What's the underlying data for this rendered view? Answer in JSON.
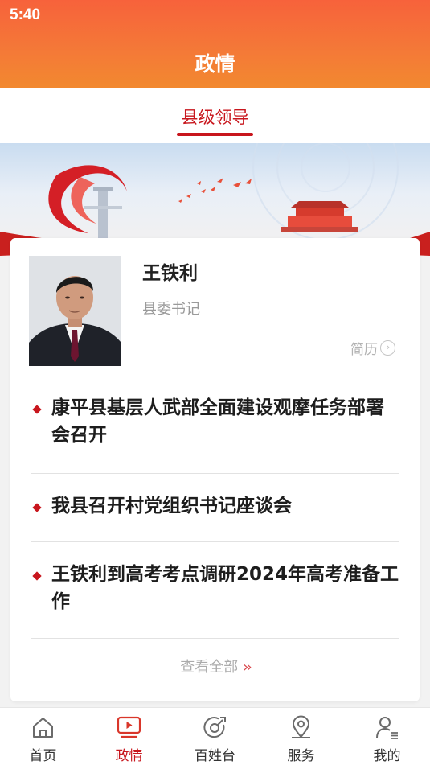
{
  "status_bar": {
    "time": "5:40"
  },
  "header": {
    "title": "政情"
  },
  "subtabs": [
    {
      "label": "县级领导",
      "active": true
    }
  ],
  "leader": {
    "name": "王铁利",
    "position": "县委书记",
    "bio_link": "简历"
  },
  "news": [
    {
      "title": "康平县基层人武部全面建设观摩任务部署会召开"
    },
    {
      "title": "我县召开村党组织书记座谈会"
    },
    {
      "title": "王铁利到高考考点调研2024年高考准备工作"
    }
  ],
  "view_all": {
    "label": "查看全部"
  },
  "bottom_nav": {
    "items": [
      {
        "label": "首页",
        "icon": "home-icon",
        "active": false
      },
      {
        "label": "政情",
        "icon": "video-screen-icon",
        "active": true
      },
      {
        "label": "百姓台",
        "icon": "chat-dial-icon",
        "active": false
      },
      {
        "label": "服务",
        "icon": "location-pin-icon",
        "active": false
      },
      {
        "label": "我的",
        "icon": "user-icon",
        "active": false
      }
    ]
  },
  "colors": {
    "header_start": "#f7623b",
    "header_end": "#f2892f",
    "accent": "#c8161d"
  }
}
